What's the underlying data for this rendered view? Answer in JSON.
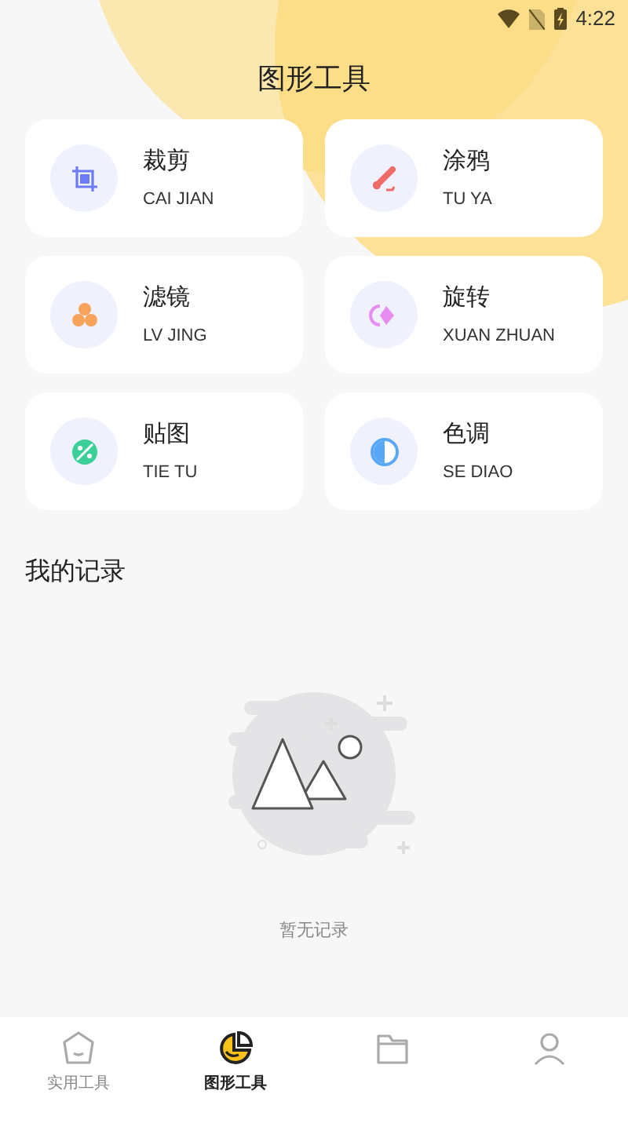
{
  "status_bar": {
    "time": "4:22"
  },
  "title": "图形工具",
  "tools": [
    {
      "name": "裁剪",
      "pinyin": "CAI JIAN"
    },
    {
      "name": "涂鸦",
      "pinyin": "TU YA"
    },
    {
      "name": "滤镜",
      "pinyin": "LV JING"
    },
    {
      "name": "旋转",
      "pinyin": "XUAN ZHUAN"
    },
    {
      "name": "贴图",
      "pinyin": "TIE TU"
    },
    {
      "name": "色调",
      "pinyin": "SE DIAO"
    }
  ],
  "records": {
    "title": "我的记录",
    "empty_text": "暂无记录"
  },
  "tabs": [
    {
      "label": "实用工具",
      "selected": false
    },
    {
      "label": "图形工具",
      "selected": true
    },
    {
      "selected": false
    },
    {
      "selected": false
    }
  ]
}
